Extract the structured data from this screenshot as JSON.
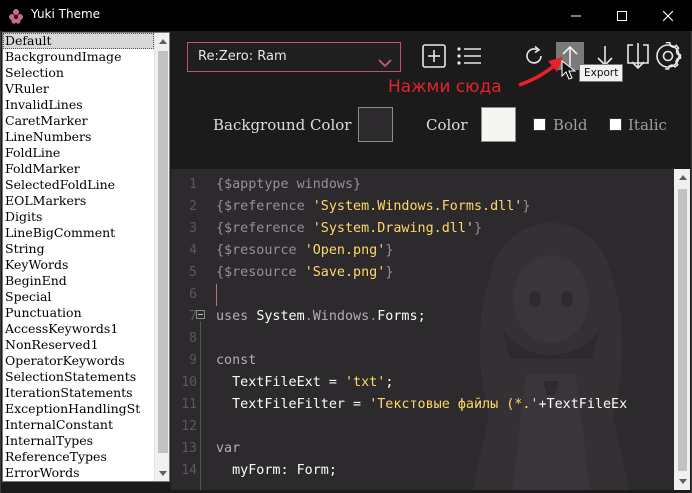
{
  "window": {
    "title": "Yuki Theme",
    "icon": "yuki-flower-icon"
  },
  "element_list": {
    "selected": "Default",
    "items": [
      "Default",
      "BackgroundImage",
      "Selection",
      "VRuler",
      "InvalidLines",
      "CaretMarker",
      "LineNumbers",
      "FoldLine",
      "FoldMarker",
      "SelectedFoldLine",
      "EOLMarkers",
      "Digits",
      "LineBigComment",
      "String",
      "KeyWords",
      "BeginEnd",
      "Special",
      "Punctuation",
      "AccessKeywords1",
      "NonReserved1",
      "OperatorKeywords",
      "SelectionStatements",
      "IterationStatements",
      "ExceptionHandlingSt",
      "InternalConstant",
      "InternalTypes",
      "ReferenceTypes",
      "ErrorWords"
    ]
  },
  "toolbar": {
    "theme_select_value": "Re:Zero: Ram",
    "icons": [
      "add-icon",
      "list-icon",
      "restore-icon",
      "export-icon",
      "import-icon",
      "download-icon",
      "settings-icon"
    ],
    "tooltip": "Export",
    "hint": "Нажми сюда",
    "accent_color": "#c0536f",
    "hint_color": "#e8202a"
  },
  "style_panel": {
    "background_color_label": "Background Color",
    "background_color_value": "#2d2a2e",
    "color_label": "Color",
    "color_value": "#f5f5f2",
    "bold_label": "Bold",
    "italic_label": "Italic",
    "bold_checked": false,
    "italic_checked": false
  },
  "editor": {
    "background": "#2d2a2e",
    "line_numbers": [
      "1",
      "2",
      "3",
      "4",
      "5",
      "6",
      "7",
      "8",
      "9",
      "10",
      "11",
      "12",
      "13",
      "14"
    ],
    "lines": [
      [
        {
          "t": "{$apptype windows}",
          "c": "dir"
        }
      ],
      [
        {
          "t": "{$reference ",
          "c": "dir"
        },
        {
          "t": "'System.Windows.Forms.dll'",
          "c": "str"
        },
        {
          "t": "}",
          "c": "dir"
        }
      ],
      [
        {
          "t": "{$reference ",
          "c": "dir"
        },
        {
          "t": "'System.Drawing.dll'",
          "c": "str"
        },
        {
          "t": "}",
          "c": "dir"
        }
      ],
      [
        {
          "t": "{$resource ",
          "c": "dir"
        },
        {
          "t": "'Open.png'",
          "c": "str"
        },
        {
          "t": "}",
          "c": "dir"
        }
      ],
      [
        {
          "t": "{$resource ",
          "c": "dir"
        },
        {
          "t": "'Save.png'",
          "c": "str"
        },
        {
          "t": "}",
          "c": "dir"
        }
      ],
      [],
      [
        {
          "t": "uses ",
          "c": "kw"
        },
        {
          "t": "System",
          "c": "id"
        },
        {
          "t": ".",
          "c": "sep"
        },
        {
          "t": "Windows",
          "c": "kw"
        },
        {
          "t": ".",
          "c": "sep"
        },
        {
          "t": "Forms",
          "c": "id"
        },
        {
          "t": ";",
          "c": "id"
        }
      ],
      [],
      [
        {
          "t": "const",
          "c": "kw"
        }
      ],
      [
        {
          "t": "  TextFileExt = ",
          "c": "id"
        },
        {
          "t": "'txt'",
          "c": "str"
        },
        {
          "t": ";",
          "c": "id"
        }
      ],
      [
        {
          "t": "  TextFileFilter = ",
          "c": "id"
        },
        {
          "t": "'Текстовые файлы (*.'",
          "c": "str"
        },
        {
          "t": "+TextFileEx",
          "c": "id"
        }
      ],
      [],
      [
        {
          "t": "var",
          "c": "kw"
        }
      ],
      [
        {
          "t": "  myForm: Form;",
          "c": "id"
        }
      ]
    ]
  }
}
